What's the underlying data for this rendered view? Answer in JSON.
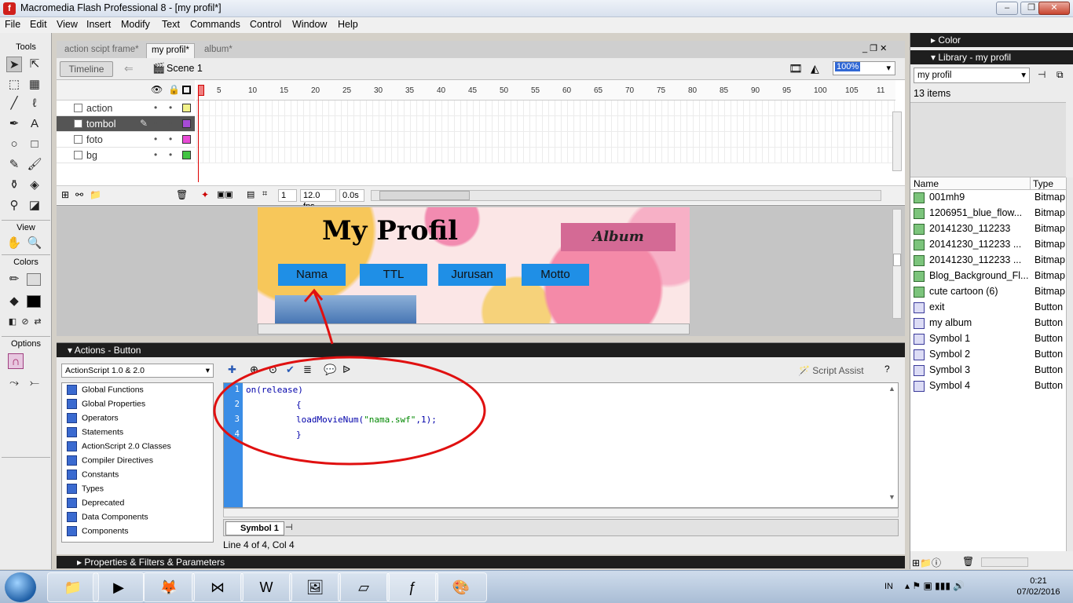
{
  "window": {
    "title": "Macromedia Flash Professional 8 - [my profil*]"
  },
  "menu": [
    "File",
    "Edit",
    "View",
    "Insert",
    "Modify",
    "Text",
    "Commands",
    "Control",
    "Window",
    "Help"
  ],
  "tools": {
    "label": "Tools",
    "view_label": "View",
    "colors_label": "Colors",
    "options_label": "Options"
  },
  "doc_tabs": [
    "action scipt frame*",
    "my profil*",
    "album*"
  ],
  "docbar": {
    "timeline_button": "Timeline",
    "scene": "Scene 1",
    "zoom": "100%"
  },
  "timeline": {
    "layers": [
      {
        "name": "action",
        "color": "#f2f28a"
      },
      {
        "name": "tombol",
        "color": "#a64bd6"
      },
      {
        "name": "foto",
        "color": "#e84bd6"
      },
      {
        "name": "bg",
        "color": "#43c443"
      }
    ],
    "ruler": [
      "1",
      "5",
      "10",
      "15",
      "20",
      "25",
      "30",
      "35",
      "40",
      "45",
      "50",
      "55",
      "60",
      "65",
      "70",
      "75",
      "80",
      "85",
      "90",
      "95",
      "100",
      "105",
      "11"
    ],
    "frame": "1",
    "fps": "12.0 fps",
    "time": "0.0s"
  },
  "stage": {
    "title": "My Profil",
    "album": "Album",
    "nav": [
      "Nama",
      "TTL",
      "Jurusan",
      "Motto"
    ]
  },
  "actions": {
    "title": "Actions - Button",
    "version": "ActionScript 1.0 & 2.0",
    "script_assist": "Script Assist",
    "tree": [
      "Global Functions",
      "Global Properties",
      "Operators",
      "Statements",
      "ActionScript 2.0 Classes",
      "Compiler Directives",
      "Constants",
      "Types",
      "Deprecated",
      "Data Components",
      "Components"
    ],
    "code": {
      "line1": "on(release)",
      "line2": "{",
      "line3_fn": "loadMovieNum(",
      "line3_str": "\"nama.swf\"",
      "line3_end": ",1);",
      "line4": "}"
    },
    "line_numbers": [
      "1",
      "2",
      "3",
      "4"
    ],
    "tab": "Symbol 1",
    "status": "Line 4 of 4, Col 4"
  },
  "properties_bar": "Properties & Filters & Parameters",
  "right": {
    "color_header": "Color",
    "library_header": "Library - my profil",
    "library_select": "my profil",
    "count": "13 items",
    "col_name": "Name",
    "col_type": "Type",
    "items": [
      {
        "name": "001mh9",
        "type": "Bitmap",
        "kind": "bitmap"
      },
      {
        "name": "1206951_blue_flow...",
        "type": "Bitmap",
        "kind": "bitmap"
      },
      {
        "name": "20141230_112233",
        "type": "Bitmap",
        "kind": "bitmap"
      },
      {
        "name": "20141230_112233 ...",
        "type": "Bitmap",
        "kind": "bitmap"
      },
      {
        "name": "20141230_112233 ...",
        "type": "Bitmap",
        "kind": "bitmap"
      },
      {
        "name": "Blog_Background_Fl...",
        "type": "Bitmap",
        "kind": "bitmap"
      },
      {
        "name": "cute cartoon (6)",
        "type": "Bitmap",
        "kind": "bitmap"
      },
      {
        "name": "exit",
        "type": "Button",
        "kind": "button"
      },
      {
        "name": "my album",
        "type": "Button",
        "kind": "button"
      },
      {
        "name": "Symbol 1",
        "type": "Button",
        "kind": "button"
      },
      {
        "name": "Symbol 2",
        "type": "Button",
        "kind": "button"
      },
      {
        "name": "Symbol 3",
        "type": "Button",
        "kind": "button"
      },
      {
        "name": "Symbol 4",
        "type": "Button",
        "kind": "button"
      }
    ]
  },
  "taskbar": {
    "lang": "IN",
    "time": "0:21",
    "date": "07/02/2016"
  }
}
